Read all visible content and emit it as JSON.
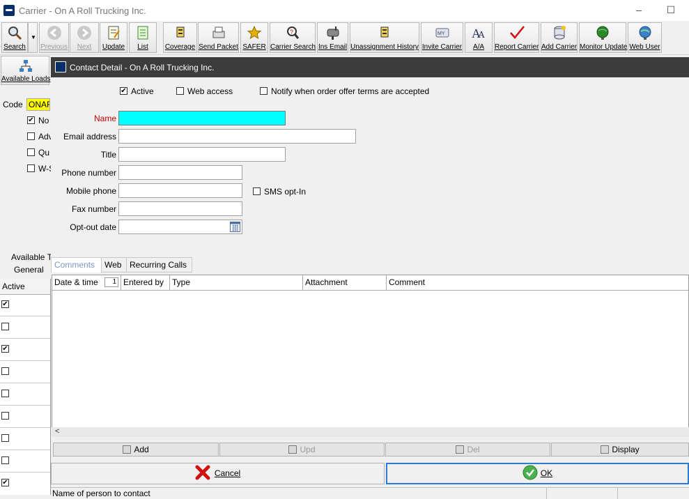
{
  "window": {
    "title": "Carrier - On A Roll Trucking Inc.",
    "minimize": "–",
    "maximize": "☐"
  },
  "toolbar": {
    "buttons": [
      {
        "label": "Search",
        "icon": "magnifier-icon",
        "enabled": true
      },
      {
        "label": "Previous",
        "icon": "arrow-left-icon",
        "enabled": false
      },
      {
        "label": "Next",
        "icon": "arrow-right-icon",
        "enabled": false
      },
      {
        "label": "Update",
        "icon": "update-icon",
        "enabled": true
      },
      {
        "label": "List",
        "icon": "list-icon",
        "enabled": true
      },
      {
        "label": "Coverage",
        "icon": "coverage-icon",
        "enabled": true
      },
      {
        "label": "Send Packet",
        "icon": "fax-icon",
        "enabled": true
      },
      {
        "label": "SAFER",
        "icon": "star-icon",
        "enabled": true
      },
      {
        "label": "Carrier Search",
        "icon": "search-doc-icon",
        "enabled": true
      },
      {
        "label": "Ins Email",
        "icon": "mailbox-icon",
        "enabled": true
      },
      {
        "label": "Unassignment History",
        "icon": "history-icon",
        "enabled": true
      },
      {
        "label": "Invite Carrier",
        "icon": "invite-icon",
        "enabled": true
      },
      {
        "label": "A/A",
        "icon": "font-icon",
        "enabled": true
      },
      {
        "label": "Report Carrier",
        "icon": "checkmark-icon",
        "enabled": true
      },
      {
        "label": "Add Carrier",
        "icon": "database-icon",
        "enabled": true
      },
      {
        "label": "Monitor Update",
        "icon": "globe-icon",
        "enabled": true
      },
      {
        "label": "Web User",
        "icon": "globe-user-icon",
        "enabled": true
      }
    ],
    "colors": {
      "star": "#e8b000",
      "check": "#d01010",
      "globe": "#2a8a2a"
    }
  },
  "left_panel": {
    "available_loads_label": "Available Loads",
    "code_label": "Code",
    "code_value": "ONAR",
    "checks": [
      {
        "label": "No",
        "checked": true
      },
      {
        "label": "Adv",
        "checked": false
      },
      {
        "label": "Qu",
        "checked": false
      },
      {
        "label": "W-S",
        "checked": false
      }
    ],
    "tab_available": "Available T",
    "tab_general": "General",
    "grid_header": "Active",
    "grid_rows": [
      true,
      false,
      true,
      false,
      false,
      false,
      false,
      false,
      true
    ]
  },
  "dialog": {
    "title": "Contact Detail - On A Roll Trucking Inc.",
    "options": [
      {
        "label": "Active",
        "checked": true
      },
      {
        "label": "Web access",
        "checked": false
      },
      {
        "label": "Notify when order offer terms are accepted",
        "checked": false
      }
    ],
    "fields": {
      "name_label": "Name",
      "name_value": "",
      "email_label": "Email address",
      "email_value": "",
      "title_label": "Title",
      "title_value": "",
      "phone_label": "Phone number",
      "phone_value": "",
      "mobile_label": "Mobile phone",
      "mobile_value": "",
      "sms_label": "SMS opt-In",
      "sms_checked": false,
      "fax_label": "Fax number",
      "fax_value": "",
      "optout_label": "Opt-out date",
      "optout_value": ""
    },
    "name_label_color": "#c00000",
    "focus_color": "#00ffff",
    "tabs": [
      {
        "label": "Comments",
        "active": true
      },
      {
        "label": "Web",
        "active": false
      },
      {
        "label": "Recurring Calls",
        "active": false
      }
    ],
    "grid": {
      "columns": [
        "Date & time",
        "Entered by",
        "Type",
        "Attachment",
        "Comment"
      ],
      "sort_indicator": "1",
      "rows": []
    },
    "row_buttons": [
      {
        "label": "Add",
        "enabled": true
      },
      {
        "label": "Upd",
        "enabled": false
      },
      {
        "label": "Del",
        "enabled": false
      },
      {
        "label": "Display",
        "enabled": true
      }
    ],
    "cancel_label": "Cancel",
    "ok_label": "OK",
    "status_text": "Name of person to contact"
  }
}
